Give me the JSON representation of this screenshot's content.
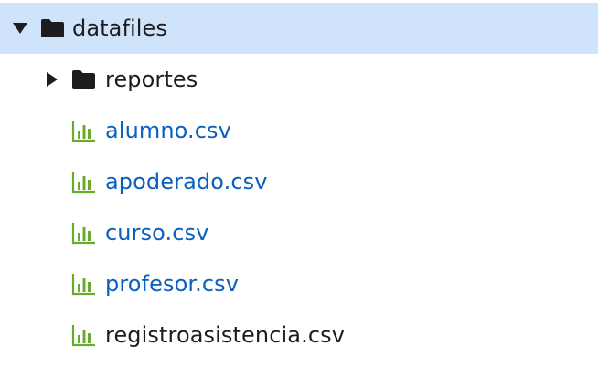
{
  "root": {
    "name": "datafiles",
    "expanded": true,
    "icon": "folder-icon",
    "text_color": "#1d1d1f",
    "selected_background": "#cfe4fb"
  },
  "subfolder": {
    "name": "reportes",
    "expanded": false,
    "icon": "folder-icon"
  },
  "files": [
    {
      "name": "alumno.csv",
      "color": "#0b5fbf",
      "icon": "chart-file-icon"
    },
    {
      "name": "apoderado.csv",
      "color": "#0b5fbf",
      "icon": "chart-file-icon"
    },
    {
      "name": "curso.csv",
      "color": "#0b5fbf",
      "icon": "chart-file-icon"
    },
    {
      "name": "profesor.csv",
      "color": "#0b5fbf",
      "icon": "chart-file-icon"
    },
    {
      "name": "registroasistencia.csv",
      "color": "#1d1d1f",
      "icon": "chart-file-icon"
    }
  ],
  "colors": {
    "csv_icon": "#6aab2f",
    "folder_icon": "#1d1d1f"
  }
}
